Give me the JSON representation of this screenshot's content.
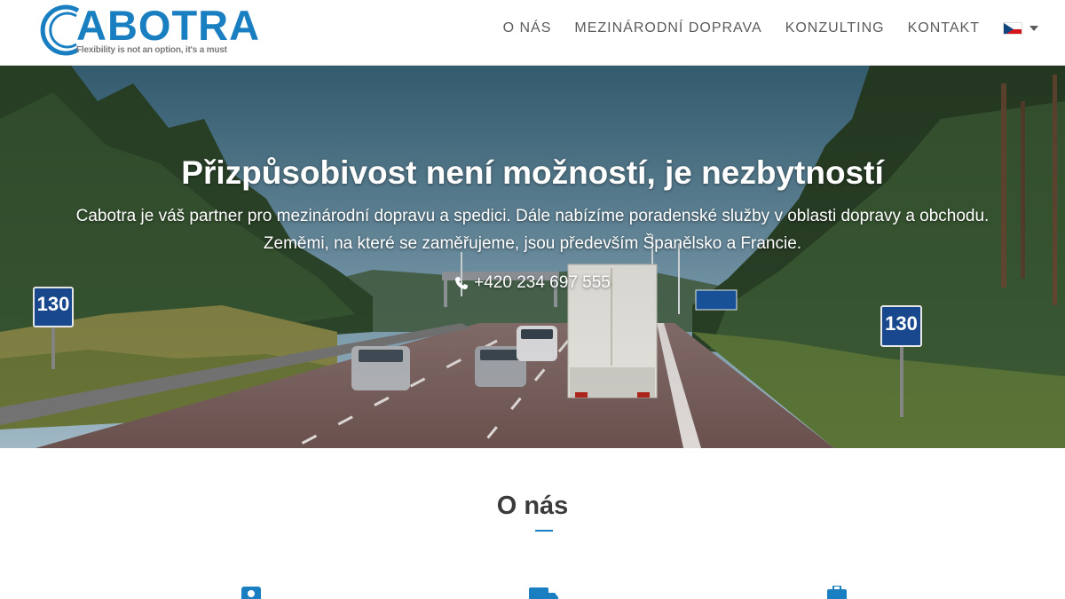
{
  "brand": {
    "name": "ABOTRA",
    "tagline": "Flexibility is not an option, it's a must",
    "color": "#1a7fc1"
  },
  "nav": {
    "items": [
      {
        "label": "O NÁS"
      },
      {
        "label": "MEZINÁRODNÍ DOPRAVA"
      },
      {
        "label": "KONZULTING"
      },
      {
        "label": "KONTAKT"
      }
    ],
    "language_icon": "czech-flag-icon"
  },
  "hero": {
    "title": "Přizpůsobivost není možností, je nezbytností",
    "text": "Cabotra je váš partner pro mezinárodní dopravu a spedici. Dále nabízíme poradenské služby v oblasti dopravy a obchodu. Zeměmi, na které se zaměřujeme, jsou především Španělsko a Francie.",
    "phone": "+420 234 697 555",
    "sign_left": "130",
    "sign_right": "130"
  },
  "about": {
    "title": "O nás",
    "feature_icons": [
      "user-icon",
      "truck-icon",
      "briefcase-icon"
    ]
  }
}
